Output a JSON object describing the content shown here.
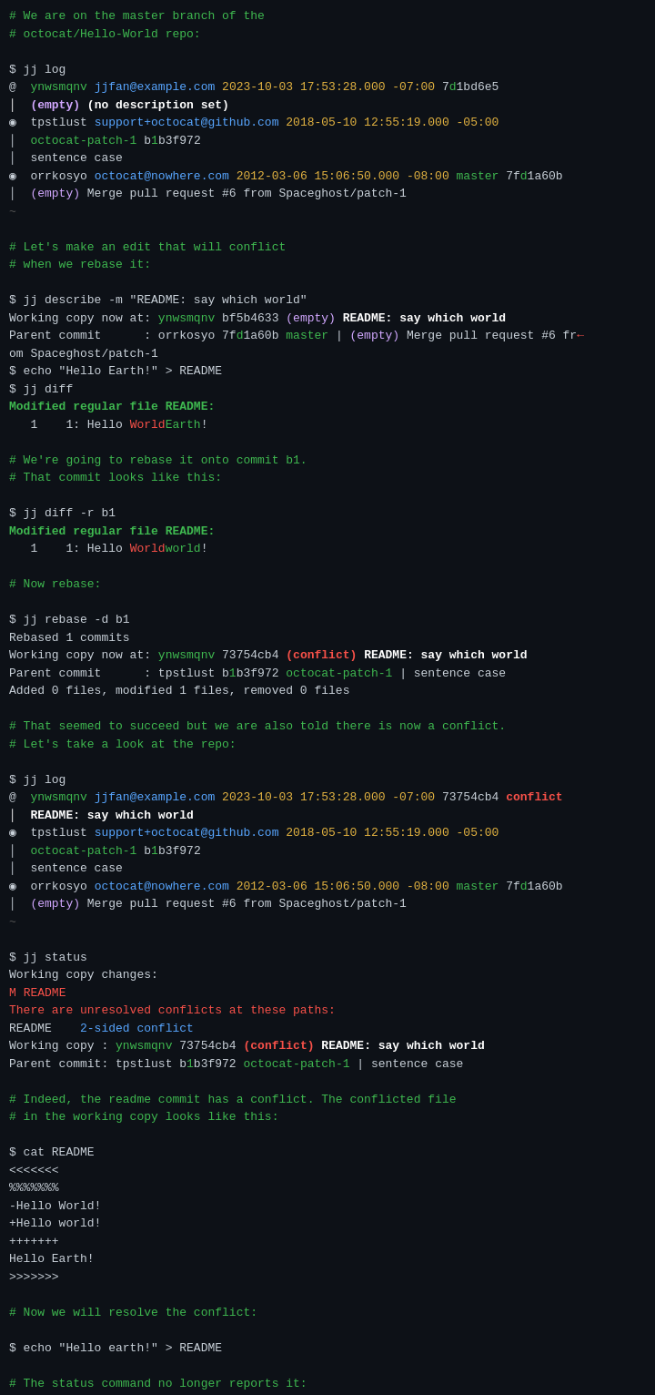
{
  "terminal": {
    "lines": []
  }
}
